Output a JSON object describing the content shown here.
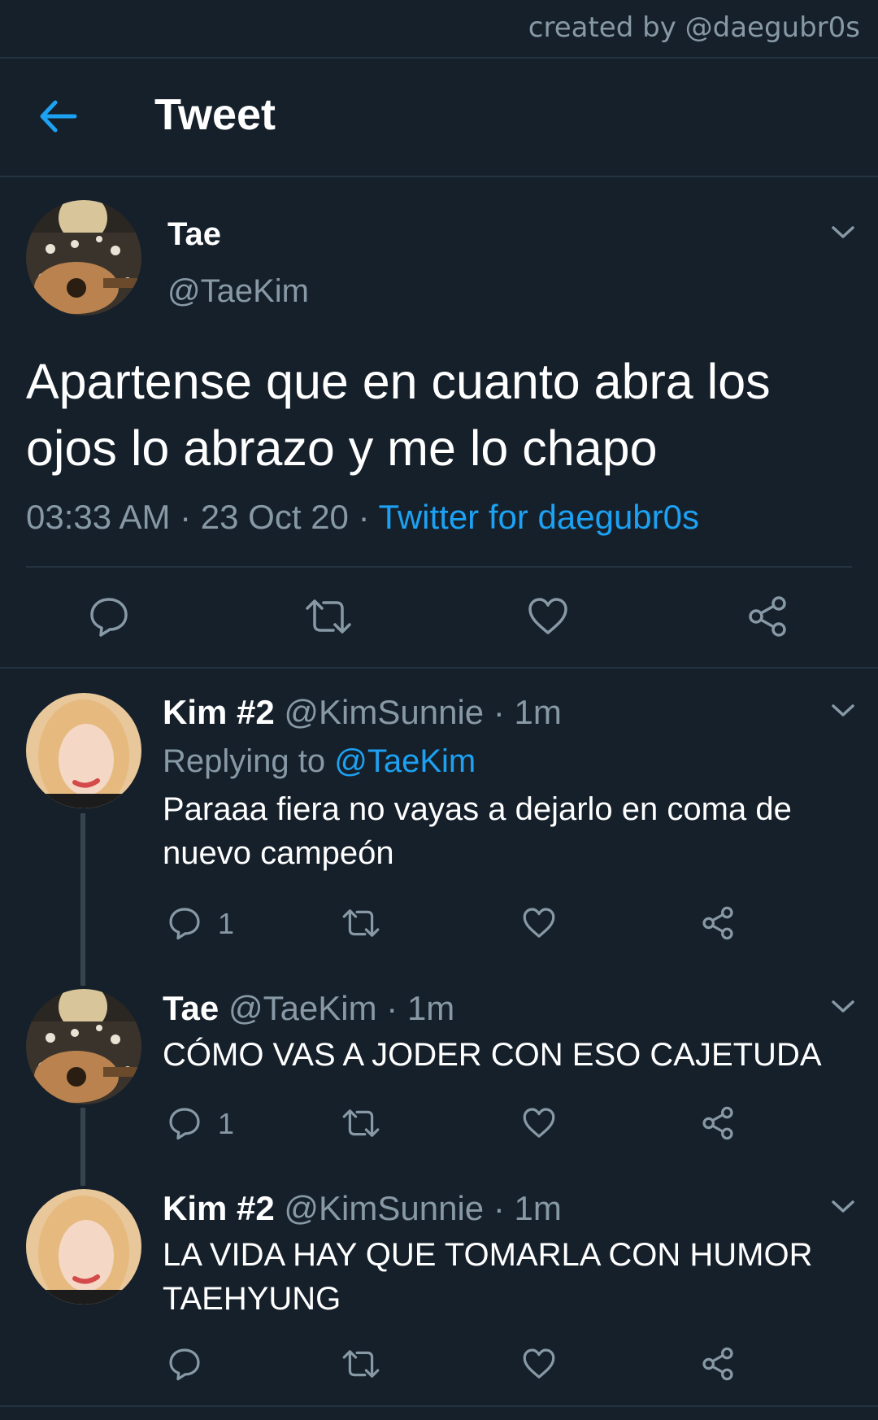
{
  "credit": "created by @daegubr0s",
  "header": {
    "title": "Tweet",
    "back_icon": "arrow-left-icon"
  },
  "colors": {
    "background": "#15202b",
    "accent": "#1da1f2",
    "muted": "#8899a6",
    "divider": "#253341"
  },
  "main_tweet": {
    "name": "Tae",
    "handle": "@TaeKim",
    "text": "Apartense que en cuanto abra los ojos lo abrazo y me lo chapo",
    "time": "03:33 AM",
    "sep1": " · ",
    "date": "23 Oct 20",
    "sep2": " · ",
    "source": "Twitter for daegubr0s",
    "actions": [
      "reply-icon",
      "retweet-icon",
      "like-icon",
      "share-icon"
    ]
  },
  "replies": [
    {
      "name": "Kim #2",
      "handle": "@KimSunnie",
      "time": " · 1m",
      "replying_prefix": "Replying to ",
      "replying_to": "@TaeKim",
      "text": "Paraaa fiera no vayas a dejarlo en coma de nuevo campeón",
      "reply_count": "1"
    },
    {
      "name": "Tae",
      "handle": "@TaeKim",
      "time": " · 1m",
      "text": "CÓMO VAS A JODER CON ESO CAJETUDA",
      "reply_count": "1"
    },
    {
      "name": "Kim #2",
      "handle": "@KimSunnie",
      "time": " · 1m",
      "text": "LA VIDA HAY QUE TOMARLA CON HUMOR TAEHYUNG",
      "reply_count": ""
    }
  ]
}
